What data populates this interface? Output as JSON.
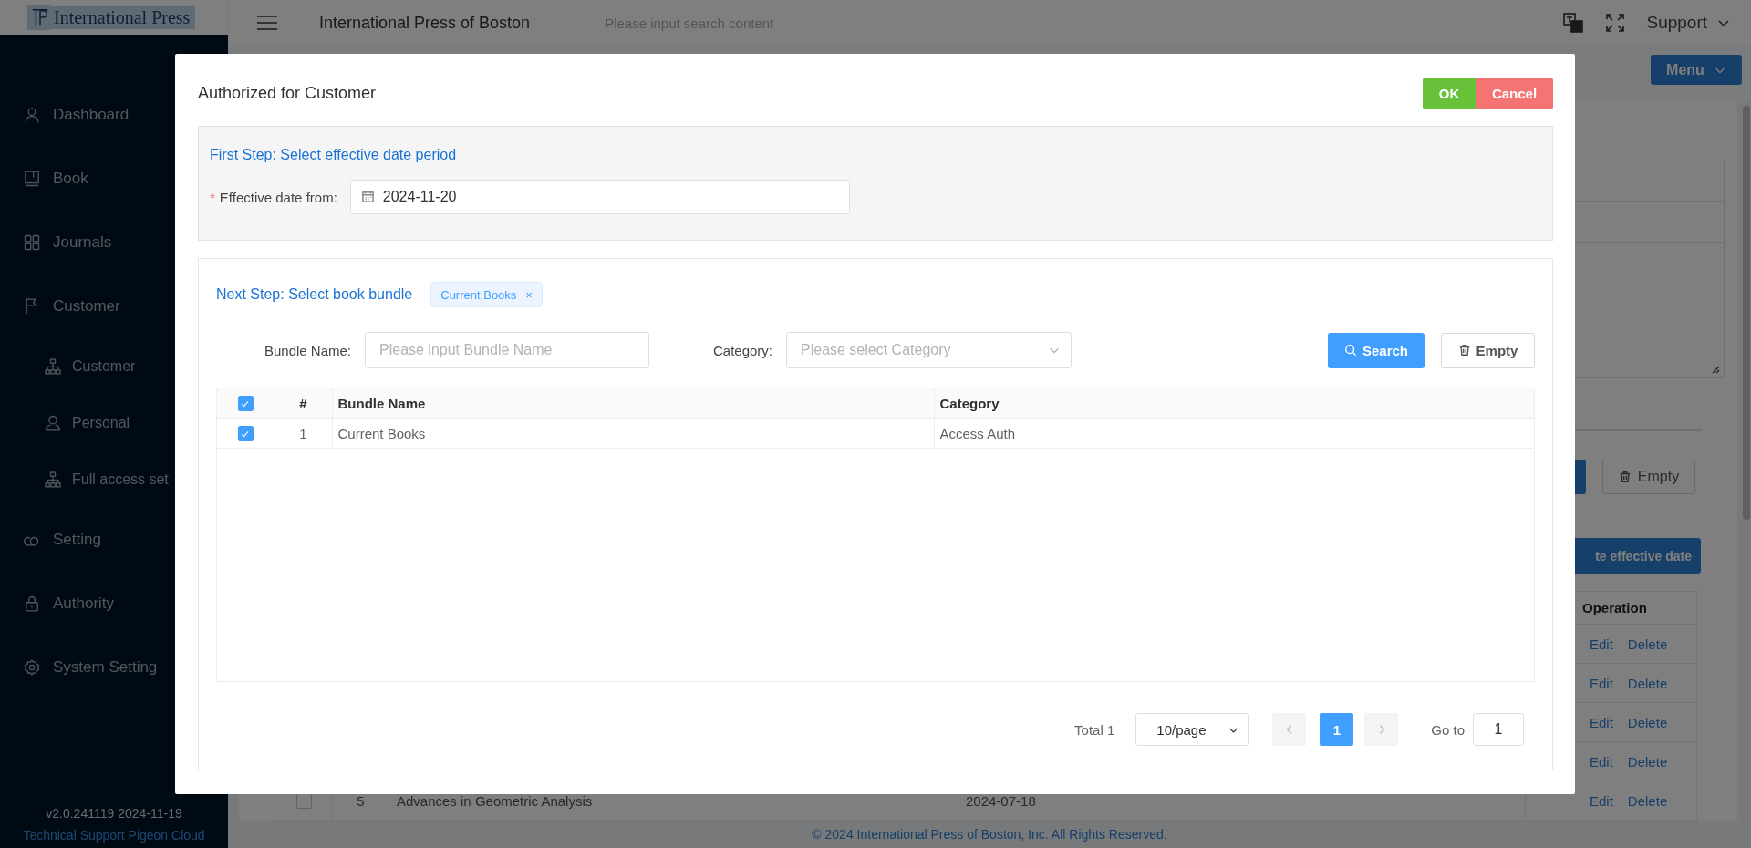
{
  "sidebar": {
    "logo": "International Press",
    "items": [
      {
        "label": "Dashboard"
      },
      {
        "label": "Book"
      },
      {
        "label": "Journals"
      },
      {
        "label": "Customer",
        "children": [
          {
            "label": "Customer"
          },
          {
            "label": "Personal"
          },
          {
            "label": "Full access set"
          }
        ]
      },
      {
        "label": "Setting"
      },
      {
        "label": "Authority"
      },
      {
        "label": "System Setting"
      }
    ],
    "version": "v2.0.241119 2024-11-19",
    "support_link": "Technical Support Pigeon Cloud"
  },
  "header": {
    "title": "International Press of Boston",
    "search_placeholder": "Please input search content",
    "user_menu": "Support"
  },
  "page": {
    "menu_button": "Menu",
    "empty_button": "Empty",
    "update_button": "te effective date",
    "table": {
      "operation_header": "Operation",
      "rows": [
        {
          "edit": "Edit",
          "delete": "Delete"
        },
        {
          "edit": "Edit",
          "delete": "Delete"
        },
        {
          "edit": "Edit",
          "delete": "Delete"
        },
        {
          "edit": "Edit",
          "delete": "Delete"
        },
        {
          "checked": false,
          "number": "5",
          "title": "Advances in Geometric Analysis",
          "date": "2024-07-18",
          "edit": "Edit",
          "delete": "Delete"
        }
      ]
    }
  },
  "footer": "© 2024 International Press of Boston, Inc. All Rights Reserved.",
  "dialog": {
    "title": "Authorized for Customer",
    "ok": "OK",
    "cancel": "Cancel",
    "step1": {
      "heading": "First Step: Select effective date period",
      "required_mark": "*",
      "label": "Effective date from:",
      "date": "2024-11-20"
    },
    "step2": {
      "heading": "Next Step: Select book bundle",
      "tags": [
        {
          "label": "Current Books",
          "close": "×"
        }
      ],
      "filters": [
        {
          "kind": "input",
          "label": "Bundle Name:",
          "placeholder": "Please input Bundle Name"
        },
        {
          "kind": "select",
          "label": "Category:",
          "placeholder": "Please select Category"
        }
      ],
      "search_button": "Search",
      "empty_button": "Empty",
      "table": {
        "all_checked": true,
        "columns": [
          "#",
          "Bundle Name",
          "Category"
        ],
        "rows": [
          {
            "checked": true,
            "cells": [
              "1",
              "Current Books",
              "Access Auth"
            ]
          }
        ]
      },
      "pagination": {
        "total": "Total 1",
        "page_size": "10/page",
        "pages": [
          {
            "label": "1",
            "selected": true
          }
        ],
        "goto_label": "Go to",
        "goto_value": "1"
      }
    }
  }
}
